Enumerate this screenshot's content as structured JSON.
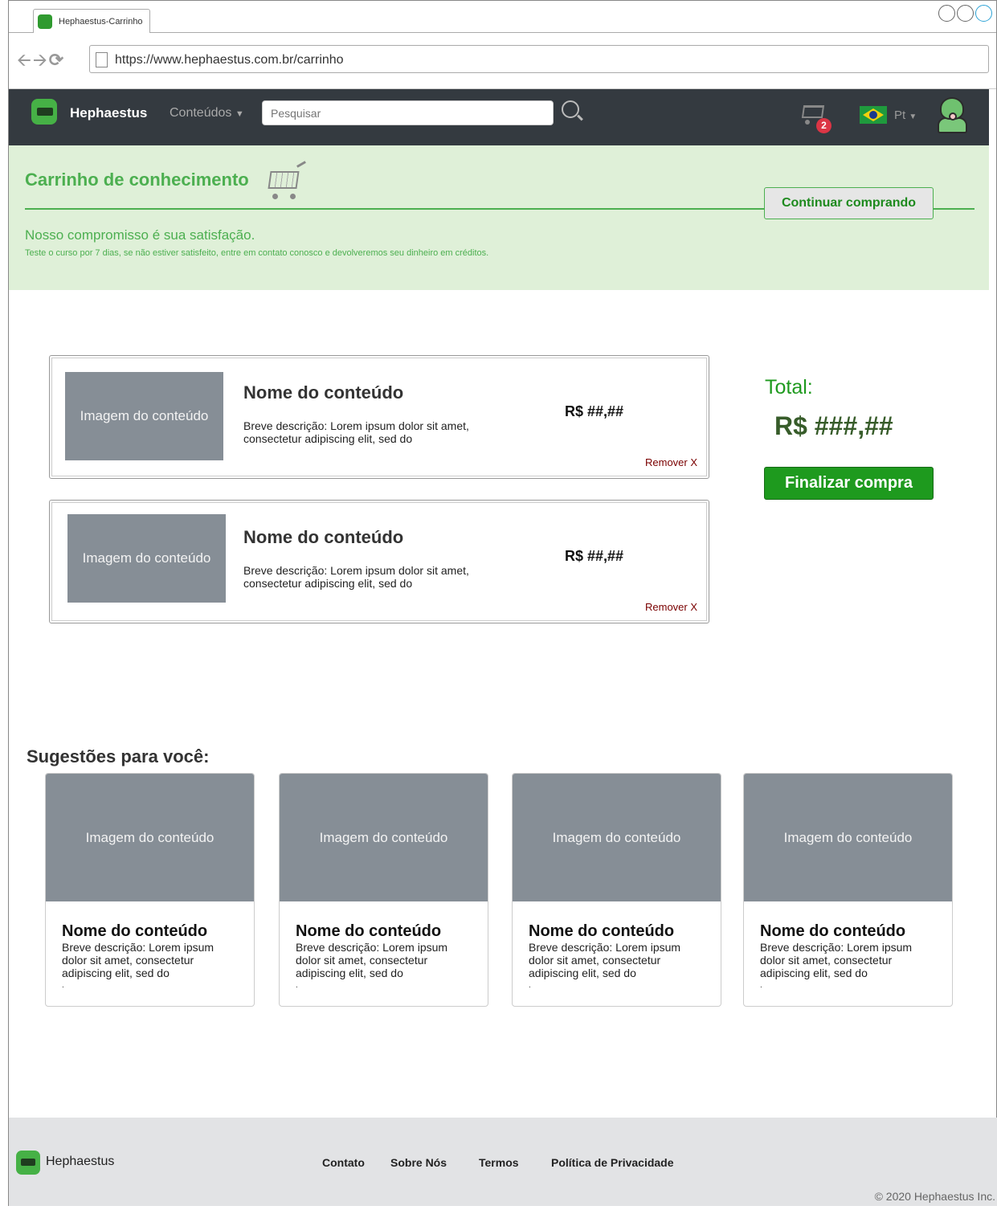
{
  "browser": {
    "tab_title": "Hephaestus-Carrinho",
    "url": "https://www.hephaestus.com.br/carrinho"
  },
  "navbar": {
    "brand": "Hephaestus",
    "menu_label": "Conteúdos",
    "search_placeholder": "Pesquisar",
    "cart_count": "2",
    "language": "Pt",
    "icons": [
      "logo-icon",
      "search-icon",
      "cart-icon",
      "brazil-flag-icon",
      "avatar-icon"
    ]
  },
  "hero": {
    "title": "Carrinho de conhecimento",
    "continue_button": "Continuar comprando",
    "subtitle": "Nosso compromisso é sua satisfação.",
    "note": "Teste o curso por 7 dias, se não estiver satisfeito, entre em contato conosco e devolveremos seu dinheiro em créditos.",
    "accent_color": "#4caf50",
    "background_color": "#dff0d8"
  },
  "cart": {
    "items": [
      {
        "image_label": "Imagem do conteúdo",
        "title": "Nome do conteúdo",
        "description": "Breve descrição: Lorem ipsum dolor sit amet, consectetur adipiscing elit, sed do",
        "price": "R$ ##,##",
        "remove_label": "Remover X"
      },
      {
        "image_label": "Imagem do conteúdo",
        "title": "Nome do conteúdo",
        "description": "Breve descrição: Lorem ipsum dolor sit amet, consectetur adipiscing elit, sed do",
        "price": "R$ ##,##",
        "remove_label": "Remover X"
      }
    ],
    "total_label": "Total:",
    "total_value": "R$ ###,##",
    "checkout_button": "Finalizar compra"
  },
  "suggestions": {
    "heading": "Sugestões para você:",
    "cards": [
      {
        "image_label": "Imagem do conteúdo",
        "title": "Nome do conteúdo",
        "description": "Breve descrição: Lorem ipsum dolor sit amet, consectetur adipiscing elit, sed do",
        "trailer": "."
      },
      {
        "image_label": "Imagem do conteúdo",
        "title": "Nome do conteúdo",
        "description": "Breve descrição: Lorem ipsum dolor sit amet, consectetur adipiscing elit, sed do",
        "trailer": "."
      },
      {
        "image_label": "Imagem do conteúdo",
        "title": "Nome do conteúdo",
        "description": "Breve descrição: Lorem ipsum dolor sit amet, consectetur adipiscing elit, sed do",
        "trailer": "."
      },
      {
        "image_label": "Imagem do conteúdo",
        "title": "Nome do conteúdo",
        "description": "Breve descrição: Lorem ipsum dolor sit amet, consectetur adipiscing elit, sed do",
        "trailer": "."
      }
    ]
  },
  "footer": {
    "brand": "Hephaestus",
    "links": [
      "Contato",
      "Sobre Nós",
      "Termos",
      "Política de Privacidade"
    ],
    "copyright": "© 2020 Hephaestus Inc."
  }
}
